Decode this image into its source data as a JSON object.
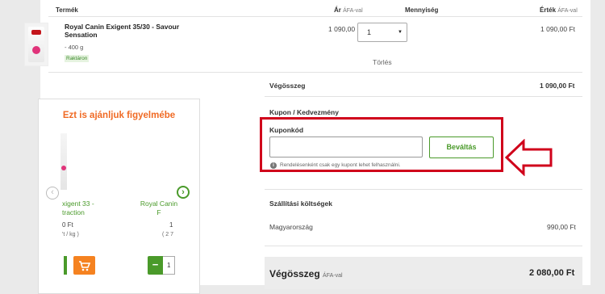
{
  "columns": {
    "product": "Termék",
    "price": "Ár",
    "price_suffix": "ÁFA-val",
    "quantity": "Mennyiség",
    "value": "Érték",
    "value_suffix": "ÁFA-val"
  },
  "cart_item": {
    "name": "Royal Canin Exigent 35/30 - Savour Sensation",
    "weight": "- 400 g",
    "stock": "Raktáron",
    "price": "1 090,00 Ft",
    "quantity": "1",
    "total": "1 090,00 Ft",
    "delete": "Törlés"
  },
  "recommend": {
    "title": "Ezt is ajánljuk figyelmébe",
    "items": [
      {
        "name_line1": "xigent 33 -",
        "name_line2": "traction",
        "price": "0 Ft",
        "unit": "'t / kg )"
      },
      {
        "name_line1": "Royal Canin",
        "name_line2": "F",
        "price": "1",
        "unit": "( 2 7"
      }
    ],
    "minus": "−",
    "qty_partial": "1"
  },
  "subtotal": {
    "label": "Végösszeg",
    "value": "1 090,00 Ft"
  },
  "coupon": {
    "section_title": "Kupon / Kedvezmény",
    "field_label": "Kuponkód",
    "input_value": "",
    "button": "Beváltás",
    "hint": "Rendelésenként csak egy kupont lehet felhasználni."
  },
  "shipping": {
    "title": "Szállítási költségek",
    "country": "Magyarország",
    "cost": "990,00 Ft"
  },
  "grand_total": {
    "label": "Végösszeg",
    "suffix": "ÁFA-val",
    "value": "2 080,00 Ft"
  },
  "colors": {
    "accent_green": "#4a9a2a",
    "accent_orange": "#f06a24",
    "highlight_red": "#d0021b"
  },
  "icons": {
    "info": "info-icon",
    "cart": "shopping-cart-icon",
    "arrow": "arrow-left-outline-icon"
  }
}
